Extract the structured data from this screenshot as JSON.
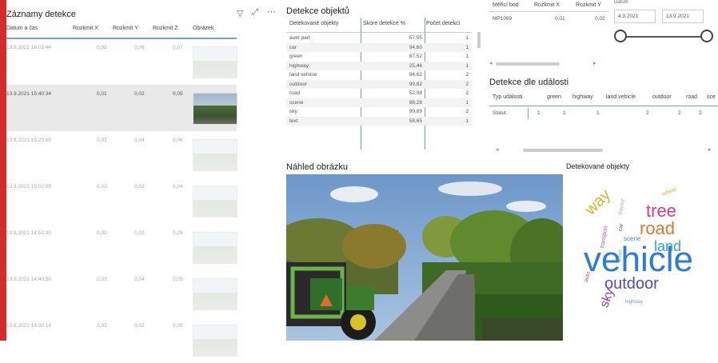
{
  "left_panel": {
    "title": "Záznamy detekce",
    "columns": [
      "Datum a čas",
      "Rozkmit X",
      "Rozkmit Y",
      "Rozkmit Z",
      "Obrázek"
    ],
    "rows": [
      {
        "datetime": "13.9.2021 16:01:44",
        "x": "0,02",
        "y": "0,06",
        "z": "0,07",
        "selected": false
      },
      {
        "datetime": "13.9.2021 15:40:34",
        "x": "0,01",
        "y": "0,02",
        "z": "0,05",
        "selected": true
      },
      {
        "datetime": "13.9.2021 15:23:00",
        "x": "0,02",
        "y": "0,04",
        "z": "0,06",
        "selected": false
      },
      {
        "datetime": "13.9.2021 15:02:09",
        "x": "0,02",
        "y": "0,02",
        "z": "0,04",
        "selected": false
      },
      {
        "datetime": "13.9.2021 14:51:30",
        "x": "0,02",
        "y": "0,02",
        "z": "0,05",
        "selected": false
      },
      {
        "datetime": "13.9.2021 14:40:50",
        "x": "0,03",
        "y": "0,04",
        "z": "0,05",
        "selected": false
      },
      {
        "datetime": "13.9.2021 14:30:14",
        "x": "0,02",
        "y": "0,02",
        "z": "0,05",
        "selected": false
      }
    ]
  },
  "icons": {
    "filter": "filter-icon",
    "focus": "focus-mode-icon",
    "more": "more-options-icon"
  },
  "detection_table": {
    "title": "Detekce objektů",
    "columns": [
      "Detekované objekty",
      "Skóre detekce %",
      "Počet detekcí"
    ],
    "rows": [
      {
        "obj": "auto part",
        "score": "57,55",
        "count": "1"
      },
      {
        "obj": "car",
        "score": "94,60",
        "count": "1"
      },
      {
        "obj": "green",
        "score": "87,52",
        "count": "1"
      },
      {
        "obj": "highway",
        "score": "25,46",
        "count": "1"
      },
      {
        "obj": "land vehicle",
        "score": "94,62",
        "count": "2"
      },
      {
        "obj": "outdoor",
        "score": "99,82",
        "count": "2"
      },
      {
        "obj": "road",
        "score": "52,98",
        "count": "2"
      },
      {
        "obj": "scene",
        "score": "88,28",
        "count": "1"
      },
      {
        "obj": "sky",
        "score": "99,89",
        "count": "2"
      },
      {
        "obj": "text",
        "score": "58,65",
        "count": "1"
      }
    ]
  },
  "measure_table": {
    "columns": [
      "Měřicí bod",
      "Rozkmit X",
      "Rozkmit Y"
    ],
    "row": {
      "point": "MP1069",
      "x": "0,01",
      "y": "0,02"
    }
  },
  "date_slicer": {
    "label": "Datum",
    "from": "4.9.2021",
    "to": "13.9.2021"
  },
  "event_table": {
    "title": "Detekce dle události",
    "columns": [
      "Typ události",
      "green",
      "highway",
      "land vehicle",
      "outdoor",
      "road",
      "sce"
    ],
    "row": [
      "Statut",
      "1",
      "1",
      "1",
      "2",
      "2",
      "2"
    ]
  },
  "preview": {
    "title": "Náhled obrázku"
  },
  "wordcloud": {
    "title": "Detekované objekty",
    "words": [
      {
        "text": "vehicle",
        "color": "#2b7bd8"
      },
      {
        "text": "road",
        "color": "#e8732c"
      },
      {
        "text": "tree",
        "color": "#d63a8e"
      },
      {
        "text": "land",
        "color": "#2fa8c4"
      },
      {
        "text": "outdoor",
        "color": "#4a4fc9"
      },
      {
        "text": "way",
        "color": "#e0b22a"
      },
      {
        "text": "sky",
        "color": "#8a3fa8"
      },
      {
        "text": "wheel",
        "color": "#d8b028"
      },
      {
        "text": "scene",
        "color": "#3c8fd2"
      },
      {
        "text": "car",
        "color": "#5a5a5a"
      },
      {
        "text": "tractor",
        "color": "#b0b0b0"
      },
      {
        "text": "highway",
        "color": "#6aa0d8"
      },
      {
        "text": "auto",
        "color": "#c04fb0"
      },
      {
        "text": "green",
        "color": "#5db85c"
      },
      {
        "text": "transport",
        "color": "#9b59b6"
      }
    ]
  }
}
